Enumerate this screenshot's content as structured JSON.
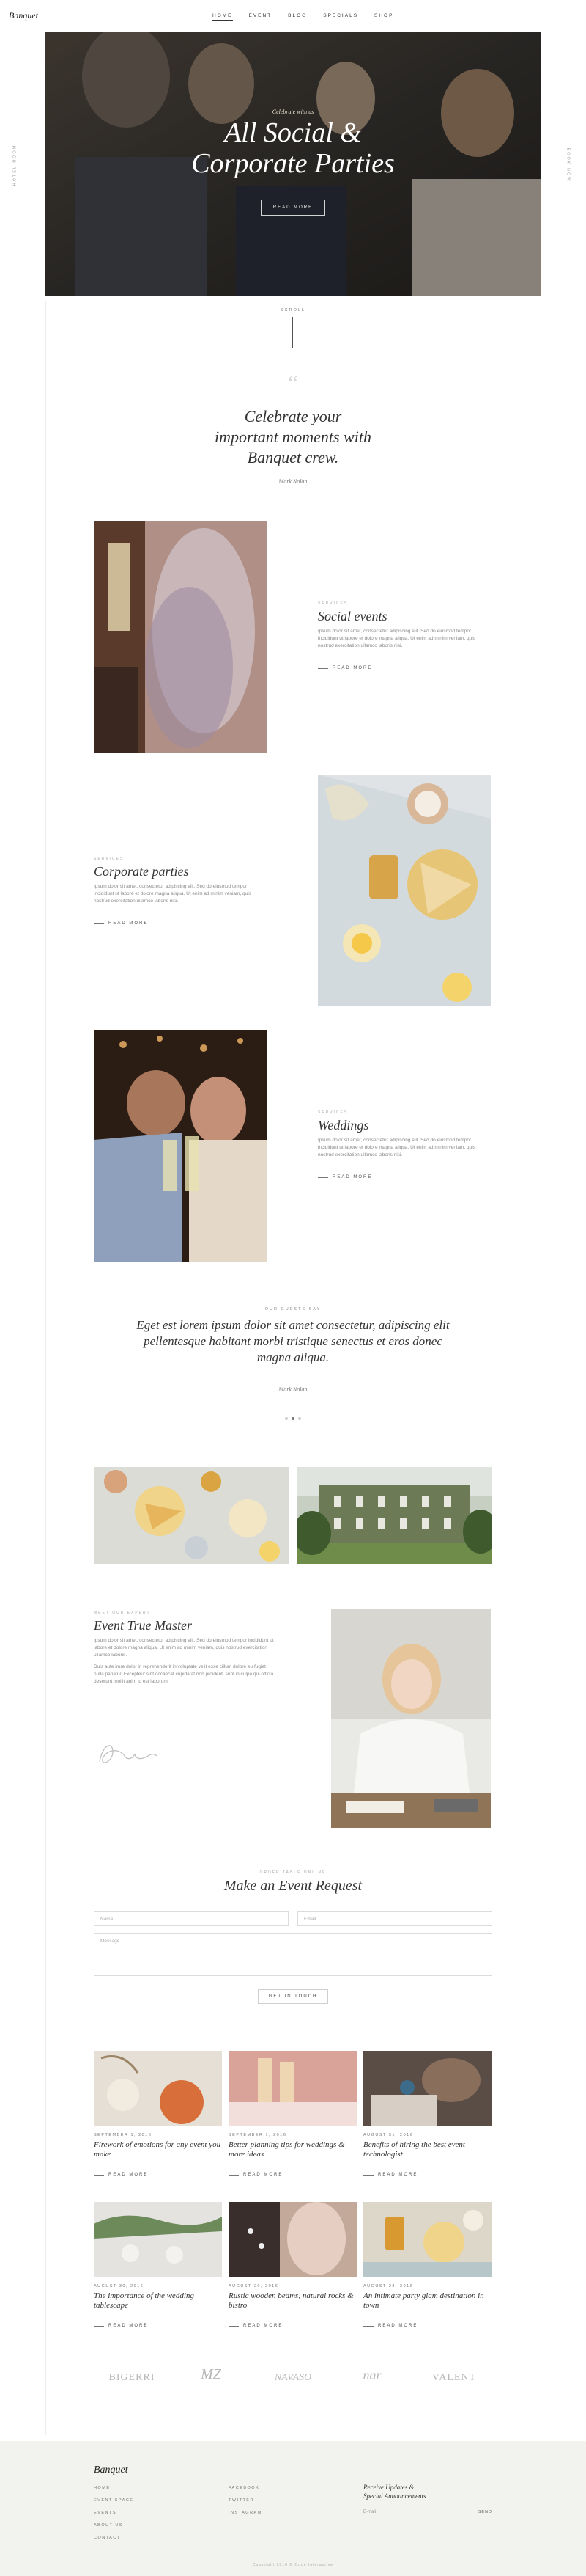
{
  "brand": {
    "logo": "Banquet"
  },
  "nav": {
    "items": [
      "Home",
      "Event",
      "Blog",
      "Specials",
      "Shop"
    ],
    "active_index": 0
  },
  "side": {
    "left_label": "Hotel Room",
    "right_label": "Book Now"
  },
  "hero": {
    "eyebrow": "Celebrate with us",
    "title_line1": "All Social &",
    "title_line2": "Corporate Parties",
    "button": "Read More"
  },
  "scroll_label": "Scroll",
  "quote": {
    "mark": "“",
    "line1": "Celebrate your",
    "line2": "important moments with",
    "line3": "Banquet crew.",
    "author": "Mark Nolan"
  },
  "events": [
    {
      "eyebrow": "Services",
      "title": "Social events",
      "text": "Ipsum dolor sit amet, consectetur adipiscing elit. Sed do eiusmod tempor incididunt ut labore et dolore magna aliqua. Ut enim ad minim veniam, quis nostrud exercitation ullamco laboris nisi.",
      "link": "Read More"
    },
    {
      "eyebrow": "Services",
      "title": "Corporate parties",
      "text": "Ipsum dolor sit amet, consectetur adipiscing elit. Sed do eiusmod tempor incididunt ut labore et dolore magna aliqua. Ut enim ad minim veniam, quis nostrud exercitation ullamco laboris nisi.",
      "link": "Read More"
    },
    {
      "eyebrow": "Services",
      "title": "Weddings",
      "text": "Ipsum dolor sit amet, consectetur adipiscing elit. Sed do eiusmod tempor incididunt ut labore et dolore magna aliqua. Ut enim ad minim veniam, quis nostrud exercitation ullamco laboris nisi.",
      "link": "Read More"
    }
  ],
  "testimonial": {
    "eyebrow": "Our Guests Say",
    "line1": "Eget est lorem ipsum dolor sit amet consectetur, adipiscing elit",
    "line2": "pellentesque habitant morbi tristique senectus et eros donec",
    "line3": "magna aliqua.",
    "author": "Mark Nolan"
  },
  "master": {
    "eyebrow": "Meet Our Expert",
    "title": "Event True Master",
    "text1": "Ipsum dolor sit amet, consectetur adipiscing elit. Sed do eiusmod tempor incididunt ut labore et dolore magna aliqua. Ut enim ad minim veniam, quis nostrud exercitation ullamco laboris.",
    "text2": "Duis aute irure dolor in reprehenderit in voluptate velit esse cillum dolore eu fugiat nulla pariatur. Excepteur sint occaecat cupidatat non proident, sunt in culpa qui officia deserunt mollit anim id est laborum."
  },
  "form": {
    "eyebrow": "Order Table Online",
    "title": "Make an Event Request",
    "name_placeholder": "Name",
    "email_placeholder": "Email",
    "message_placeholder": "Message",
    "submit": "Get in Touch"
  },
  "posts": [
    {
      "date": "September 1, 2016",
      "title": "Firework of emotions for any event you make",
      "link": "Read More"
    },
    {
      "date": "September 1, 2016",
      "title": "Better planning tips for weddings & more ideas",
      "link": "Read More"
    },
    {
      "date": "August 31, 2016",
      "title": "Benefits of hiring the best event technologist",
      "link": "Read More"
    },
    {
      "date": "August 30, 2016",
      "title": "The importance of the wedding tablescape",
      "link": "Read More"
    },
    {
      "date": "August 29, 2016",
      "title": "Rustic wooden beams, natural rocks & bistro",
      "link": "Read More"
    },
    {
      "date": "August 28, 2016",
      "title": "An intimate party glam destination in town",
      "link": "Read More"
    }
  ],
  "logos": [
    "BIGERRI",
    "MZ",
    "NAVASO",
    "nar",
    "VALENT"
  ],
  "footer": {
    "logo": "Banquet",
    "col1": [
      "Home",
      "Event Space",
      "Events",
      "About Us",
      "Contact"
    ],
    "col2": [
      "Facebook",
      "Twitter",
      "Instagram"
    ],
    "newsletter_line1": "Receive Updates &",
    "newsletter_line2": "Special Announcements",
    "email_placeholder": "E-mail",
    "send": "Send",
    "copyright": "Copyright 2016 © Qode Interactive"
  },
  "colors": {
    "accent": "#c9b27a",
    "footer_bg": "#f2f2ee",
    "text_dark": "#222222"
  }
}
